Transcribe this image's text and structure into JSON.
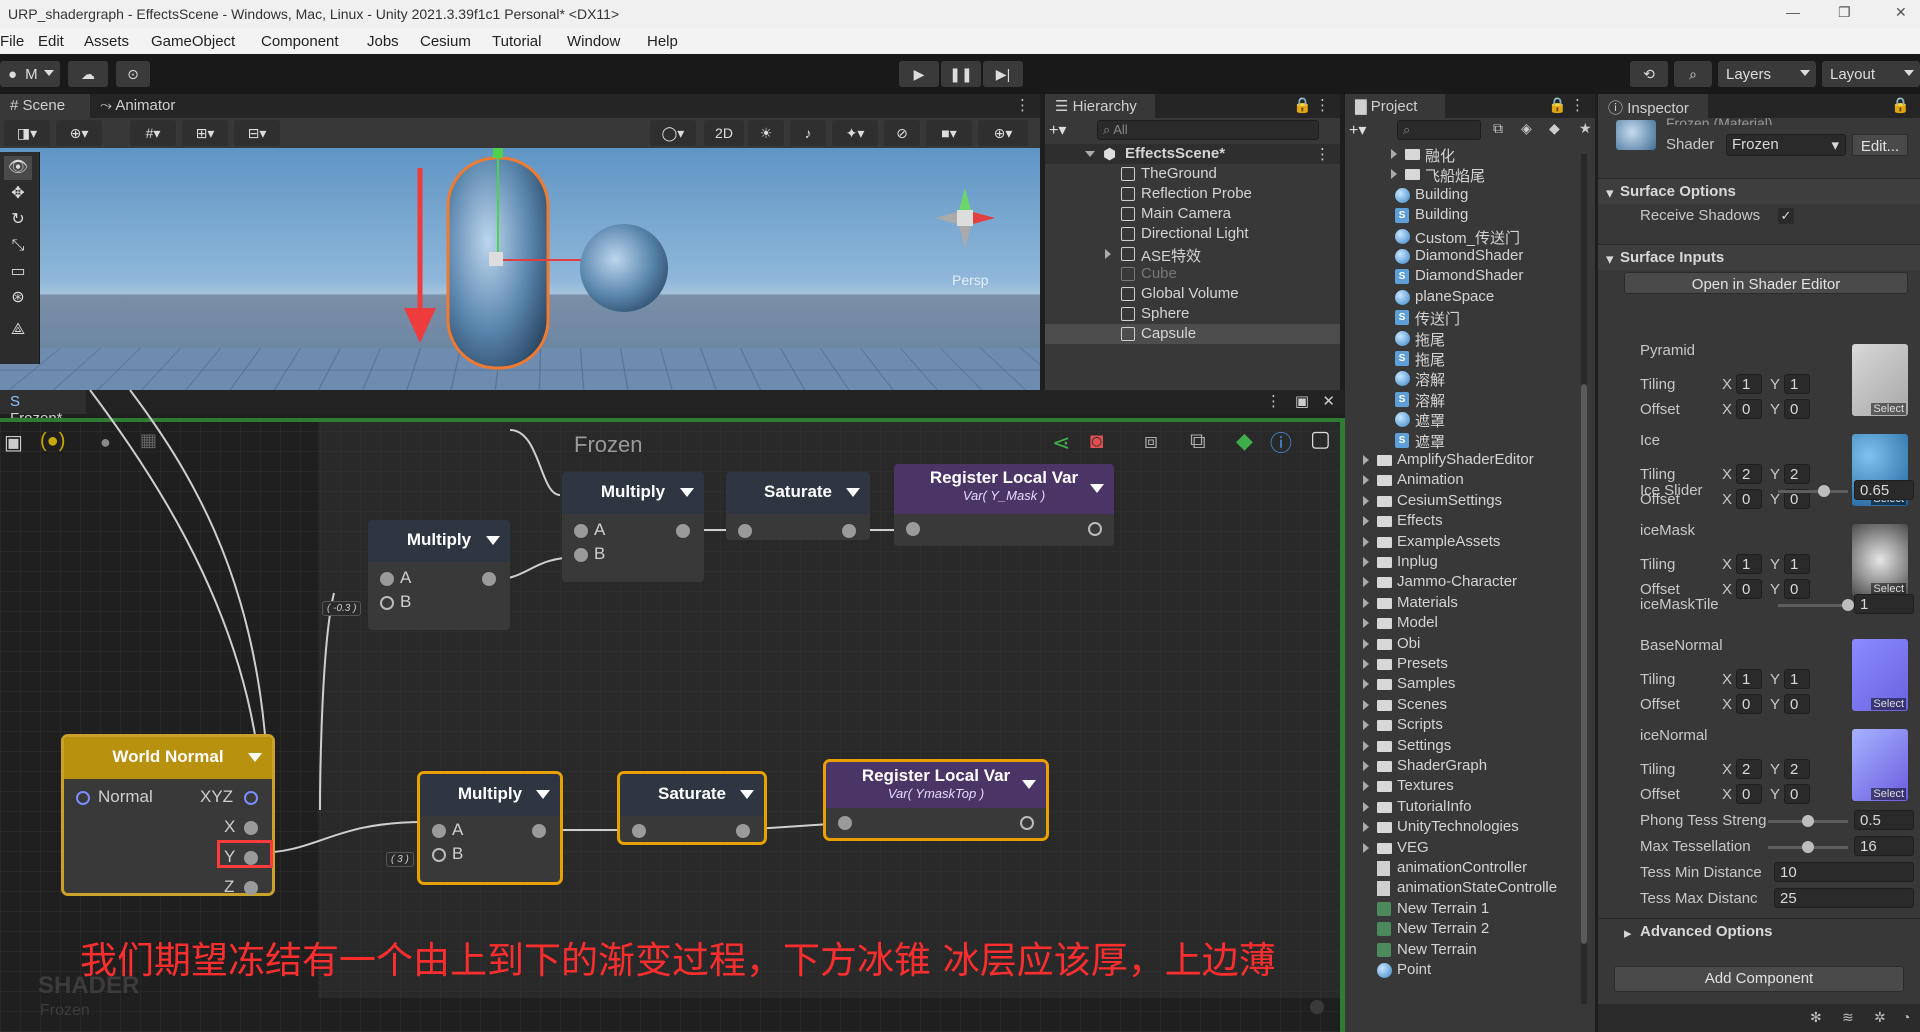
{
  "window": {
    "title": "URP_shadergraph - EffectsScene - Windows, Mac, Linux - Unity 2021.3.39f1c1 Personal* <DX11>"
  },
  "menu": [
    "File",
    "Edit",
    "Assets",
    "GameObject",
    "Component",
    "Jobs",
    "Cesium",
    "Tutorial",
    "Window",
    "Help"
  ],
  "toolbar": {
    "account": "M",
    "layers_label": "Layers",
    "layout_label": "Layout"
  },
  "scene": {
    "tab_scene": "Scene",
    "tab_animator": "Animator",
    "mode_2d": "2D",
    "persp_label": "Persp"
  },
  "shadergraph": {
    "tab_label": "Frozen*",
    "graph_title": "Frozen",
    "watermark_title": "SHADER",
    "watermark_sub": "Frozen",
    "caption": "我们期望冻结有一个由上到下的渐变过程，下方冰锥 冰层应该厚，上边薄",
    "nodes": {
      "multiply_top": {
        "title": "Multiply",
        "a": "A",
        "b": "B"
      },
      "saturate_top": {
        "title": "Saturate"
      },
      "register_top": {
        "title": "Register Local Var",
        "sub": "Var( Y_Mask )"
      },
      "multiply_left": {
        "title": "Multiply",
        "a": "A",
        "b": "B",
        "chip": "( -0.3 )"
      },
      "world_normal": {
        "title": "World Normal",
        "normal": "Normal",
        "xyz": "XYZ",
        "x": "X",
        "y": "Y",
        "z": "Z"
      },
      "multiply_bottom": {
        "title": "Multiply",
        "a": "A",
        "b": "B",
        "chip": "( 3 )"
      },
      "saturate_bottom": {
        "title": "Saturate"
      },
      "register_bottom": {
        "title": "Register Local Var",
        "sub": "Var( YmaskTop )"
      }
    }
  },
  "hierarchy": {
    "tab_label": "Hierarchy",
    "search_placeholder": "All",
    "scene_name": "EffectsScene*",
    "items": [
      "TheGround",
      "Reflection Probe",
      "Main Camera",
      "Directional Light",
      "ASE特效",
      "Cube",
      "Global Volume",
      "Sphere",
      "Capsule"
    ]
  },
  "project": {
    "tab_label": "Project",
    "items": [
      {
        "label": "融化",
        "kind": "folder"
      },
      {
        "label": "飞船焰尾",
        "kind": "folder"
      },
      {
        "label": "Building",
        "kind": "material"
      },
      {
        "label": "Building",
        "kind": "shader"
      },
      {
        "label": "Custom_传送门",
        "kind": "material"
      },
      {
        "label": "DiamondShader",
        "kind": "material"
      },
      {
        "label": "DiamondShader",
        "kind": "shader"
      },
      {
        "label": "planeSpace",
        "kind": "material"
      },
      {
        "label": "传送门",
        "kind": "shader"
      },
      {
        "label": "拖尾",
        "kind": "material"
      },
      {
        "label": "拖尾",
        "kind": "shader"
      },
      {
        "label": "溶解",
        "kind": "material"
      },
      {
        "label": "溶解",
        "kind": "shader"
      },
      {
        "label": "遮罩",
        "kind": "material"
      },
      {
        "label": "遮罩",
        "kind": "shader"
      },
      {
        "label": "AmplifyShaderEditor",
        "kind": "folder"
      },
      {
        "label": "Animation",
        "kind": "folder"
      },
      {
        "label": "CesiumSettings",
        "kind": "folder"
      },
      {
        "label": "Effects",
        "kind": "folder"
      },
      {
        "label": "ExampleAssets",
        "kind": "folder"
      },
      {
        "label": "Inplug",
        "kind": "folder"
      },
      {
        "label": "Jammo-Character",
        "kind": "folder"
      },
      {
        "label": "Materials",
        "kind": "folder"
      },
      {
        "label": "Model",
        "kind": "folder"
      },
      {
        "label": "Obi",
        "kind": "folder"
      },
      {
        "label": "Presets",
        "kind": "folder"
      },
      {
        "label": "Samples",
        "kind": "folder"
      },
      {
        "label": "Scenes",
        "kind": "folder"
      },
      {
        "label": "Scripts",
        "kind": "folder"
      },
      {
        "label": "Settings",
        "kind": "folder"
      },
      {
        "label": "ShaderGraph",
        "kind": "folder"
      },
      {
        "label": "Textures",
        "kind": "folder"
      },
      {
        "label": "TutorialInfo",
        "kind": "folder"
      },
      {
        "label": "UnityTechnologies",
        "kind": "folder"
      },
      {
        "label": "VEG",
        "kind": "folder"
      },
      {
        "label": "animationController",
        "kind": "asset"
      },
      {
        "label": "animationStateControlle",
        "kind": "asset"
      },
      {
        "label": "New Terrain 1",
        "kind": "terrain"
      },
      {
        "label": "New Terrain 2",
        "kind": "terrain"
      },
      {
        "label": "New Terrain",
        "kind": "terrain"
      },
      {
        "label": "Point",
        "kind": "material"
      }
    ]
  },
  "inspector": {
    "tab_label": "Inspector",
    "material_name": "Frozen (Material)",
    "shader_label": "Shader",
    "shader_value": "Frozen",
    "edit_button": "Edit...",
    "surface_options": "Surface Options",
    "receive_shadows": "Receive Shadows",
    "receive_shadows_check": "✓",
    "surface_inputs": "Surface Inputs",
    "open_shader_editor": "Open in Shader Editor",
    "tiling": "Tiling",
    "offset": "Offset",
    "x": "X",
    "y": "Y",
    "select": "Select",
    "textures": [
      {
        "name": "Pyramid",
        "tiling": [
          "1",
          "1"
        ],
        "offset": [
          "0",
          "0"
        ]
      },
      {
        "name": "Ice",
        "tiling": [
          "2",
          "2"
        ],
        "offset": [
          "0",
          "0"
        ]
      },
      {
        "name": "iceMask",
        "tiling": [
          "1",
          "1"
        ],
        "offset": [
          "0",
          "0"
        ]
      },
      {
        "name": "BaseNormal",
        "tiling": [
          "1",
          "1"
        ],
        "offset": [
          "0",
          "0"
        ]
      },
      {
        "name": "iceNormal",
        "tiling": [
          "2",
          "2"
        ],
        "offset": [
          "0",
          "0"
        ]
      }
    ],
    "ice_slider": {
      "label": "Ice Slider",
      "value": "0.65",
      "fraction": 0.65
    },
    "ice_mask_tile": {
      "label": "iceMaskTile",
      "value": "1",
      "fraction": 1.0
    },
    "phong": {
      "label": "Phong Tess Streng",
      "value": "0.5",
      "fraction": 0.5
    },
    "max_tess": {
      "label": "Max Tessellation",
      "value": "16",
      "fraction": 0.5
    },
    "tess_min": {
      "label": "Tess Min Distance",
      "value": "10"
    },
    "tess_max": {
      "label": "Tess Max Distanc",
      "value": "25"
    },
    "advanced": "Advanced Options",
    "add_component": "Add Component"
  }
}
